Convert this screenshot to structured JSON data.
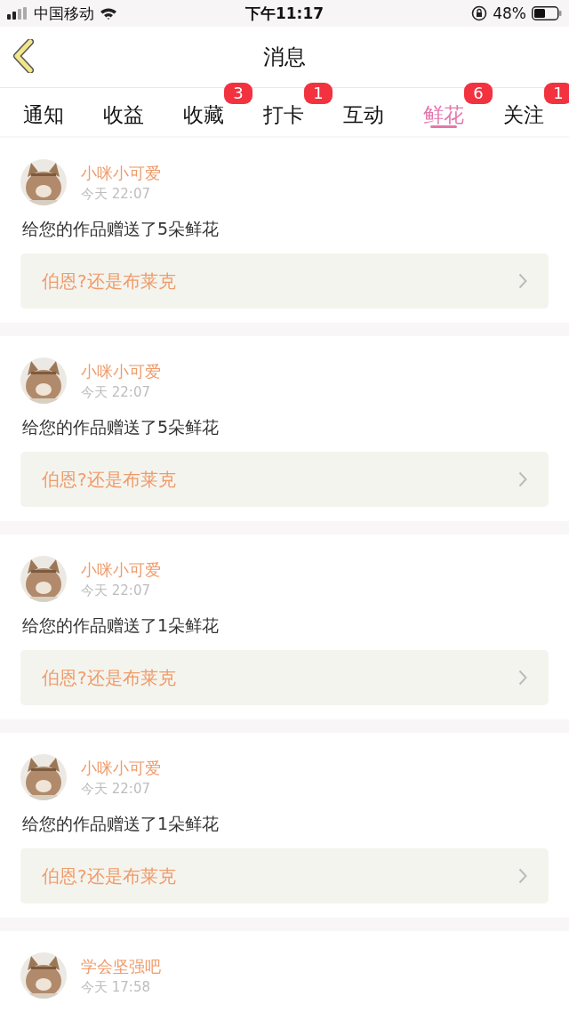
{
  "status_bar": {
    "carrier": "中国移动",
    "time": "下午11:17",
    "battery": "48%"
  },
  "nav": {
    "title": "消息"
  },
  "tabs": [
    {
      "label": "通知",
      "selected": false
    },
    {
      "label": "收益",
      "selected": false
    },
    {
      "label": "收藏",
      "selected": false,
      "badge": "3"
    },
    {
      "label": "打卡",
      "selected": false,
      "badge": "1"
    },
    {
      "label": "互动",
      "selected": false
    },
    {
      "label": "鲜花",
      "selected": true,
      "badge": "6"
    },
    {
      "label": "关注",
      "selected": false,
      "badge": "1"
    }
  ],
  "messages": [
    {
      "name": "小咪小可爱",
      "time": "今天 22:07",
      "text": "给您的作品赠送了5朵鲜花",
      "work": "伯恩?还是布莱克"
    },
    {
      "name": "小咪小可爱",
      "time": "今天 22:07",
      "text": "给您的作品赠送了5朵鲜花",
      "work": "伯恩?还是布莱克"
    },
    {
      "name": "小咪小可爱",
      "time": "今天 22:07",
      "text": "给您的作品赠送了1朵鲜花",
      "work": "伯恩?还是布莱克"
    },
    {
      "name": "小咪小可爱",
      "time": "今天 22:07",
      "text": "给您的作品赠送了1朵鲜花",
      "work": "伯恩?还是布莱克"
    },
    {
      "name": "学会坚强吧",
      "time": "今天 17:58"
    }
  ]
}
